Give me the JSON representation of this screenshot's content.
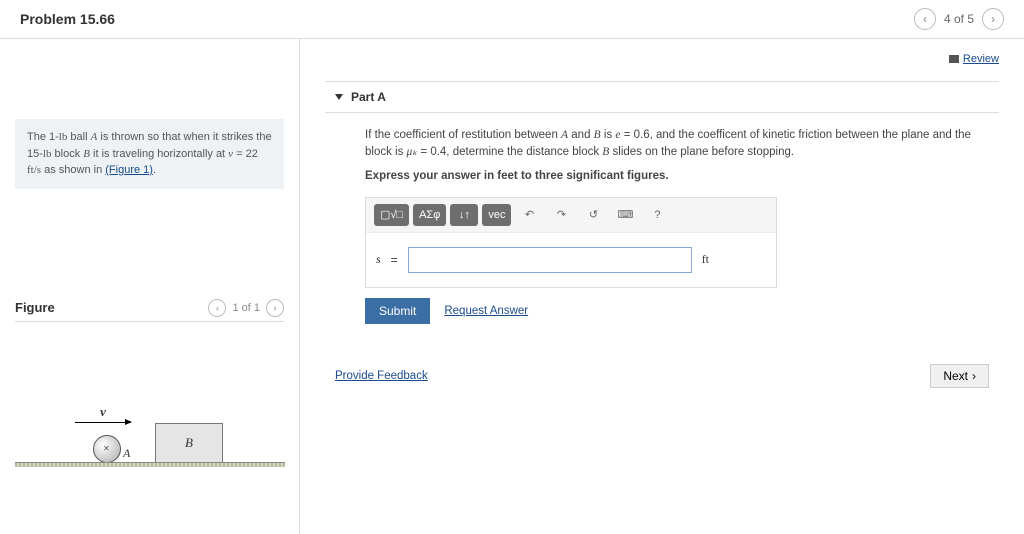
{
  "header": {
    "title": "Problem 15.66",
    "position": "4 of 5"
  },
  "review_label": "Review",
  "problem": {
    "text_prefix": "The 1-",
    "lb1": "lb",
    "text_mid1": " ball ",
    "A": "A",
    "text_mid2": " is thrown so that when it strikes the 15-",
    "lb2": "lb",
    "text_mid3": " block ",
    "B": "B",
    "text_mid4": " it is traveling horizontally at ",
    "v": "v",
    "text_mid5": " = 22 ",
    "fts": "ft/s",
    "text_mid6": " as shown in ",
    "figlink": "(Figure 1)",
    "text_end": "."
  },
  "figure": {
    "title": "Figure",
    "pager": "1 of 1",
    "ball_label": "A",
    "block_label": "B",
    "vel_label": "v"
  },
  "part": {
    "label": "Part A",
    "q1": "If the coefficient of restitution between ",
    "A": "A",
    "q2": " and ",
    "B": "B",
    "q3": " is ",
    "e": "e",
    "q4": " = 0.6, and the coefficent of kinetic friction between the plane and the block is ",
    "mu": "μₖ",
    "q5": " = 0.4, determine the distance block ",
    "B2": "B",
    "q6": " slides on the plane before stopping.",
    "instr": "Express your answer in feet to three significant figures.",
    "var": "s",
    "eq": "=",
    "unit": "ft"
  },
  "toolbar": {
    "templates": "▢√□",
    "symbols": "ΑΣφ",
    "subsup": "↓↑",
    "vec": "vec",
    "undo": "↶",
    "redo": "↷",
    "reset": "↺",
    "keyboard": "⌨",
    "help": "?"
  },
  "buttons": {
    "submit": "Submit",
    "request": "Request Answer",
    "feedback": "Provide Feedback",
    "next": "Next"
  }
}
